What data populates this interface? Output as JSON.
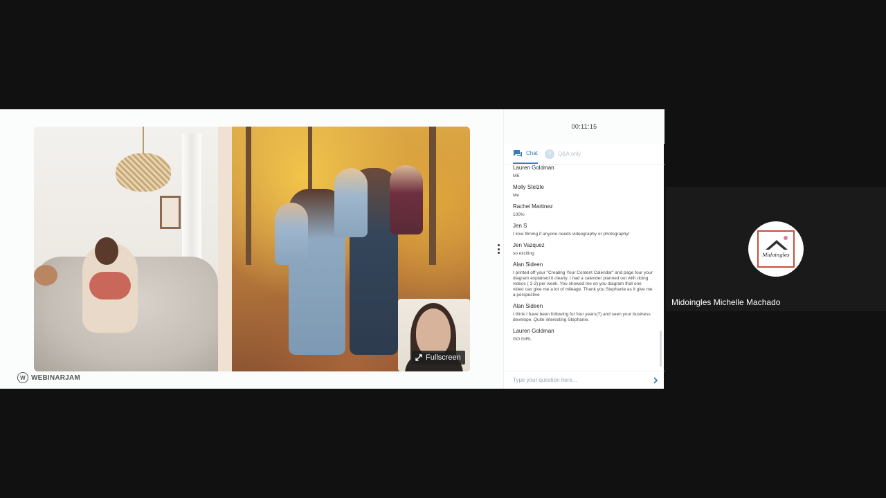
{
  "webinar": {
    "timer": "00:11:15",
    "fullscreen_label": "Fullscreen",
    "brand": "WEBINARJAM",
    "brand_logo_letter": "W"
  },
  "chat": {
    "tabs": {
      "chat_label": "Chat",
      "qa_label": "Q&A only",
      "qa_badge": "?"
    },
    "messages": [
      {
        "author": "Lauren Goldman",
        "text": "ME"
      },
      {
        "author": "Molly Stelzle",
        "text": "Me"
      },
      {
        "author": "Rachel Martinez",
        "text": "100%"
      },
      {
        "author": "Jen S",
        "text": "I love filming if anyone needs videography or photography!"
      },
      {
        "author": "Jen Vazquez",
        "text": "so exciting"
      },
      {
        "author": "Alan Sideen",
        "text": "I printed off your \"Creating Your Content Calendar\" and page four your diagram explained it clearly. I had a calender planned out with doing videos ( 2-3) per week. You showed me on you diagram that one video can give me a lot of mileage. Thank you Stephanie as it give me a perspective"
      },
      {
        "author": "Alan Sideen",
        "text": "I think I have been following for four years(?) and seen your business develope. Quite interesting Stephanie."
      },
      {
        "author": "Lauren Goldman",
        "text": "GO GIRL"
      }
    ],
    "input_placeholder": "Type your question here...",
    "accent_color": "#3a7bbf"
  },
  "participant": {
    "name": "Midoingles Michelle Machado",
    "avatar_text": "Midoingles"
  },
  "icons": {
    "chat": "chat-bubble-icon",
    "fullscreen": "expand-arrows-icon",
    "send": "chevron-right-icon",
    "menu": "kebab-menu-icon"
  }
}
